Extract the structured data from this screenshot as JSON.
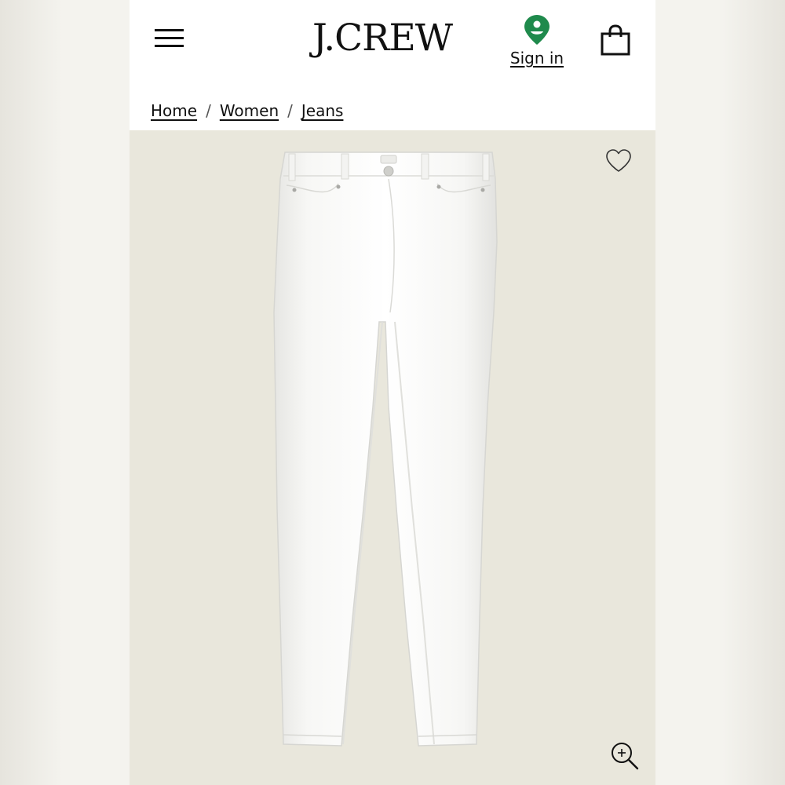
{
  "header": {
    "logo_text": "J.CREW",
    "sign_in_label": "Sign in",
    "icons": {
      "menu": "hamburger-menu-icon",
      "account": "location-pin-user-icon",
      "bag": "shopping-bag-icon"
    },
    "colors": {
      "accent_green": "#1f8a4c",
      "text": "#111111"
    }
  },
  "breadcrumb": {
    "items": [
      {
        "label": "Home"
      },
      {
        "label": "Women"
      },
      {
        "label": "Jeans"
      }
    ],
    "separator": "/"
  },
  "product": {
    "image_subject": "white jeans",
    "background_color": "#e9e7dc",
    "icons": {
      "wishlist": "heart-icon",
      "zoom": "zoom-in-icon"
    }
  }
}
